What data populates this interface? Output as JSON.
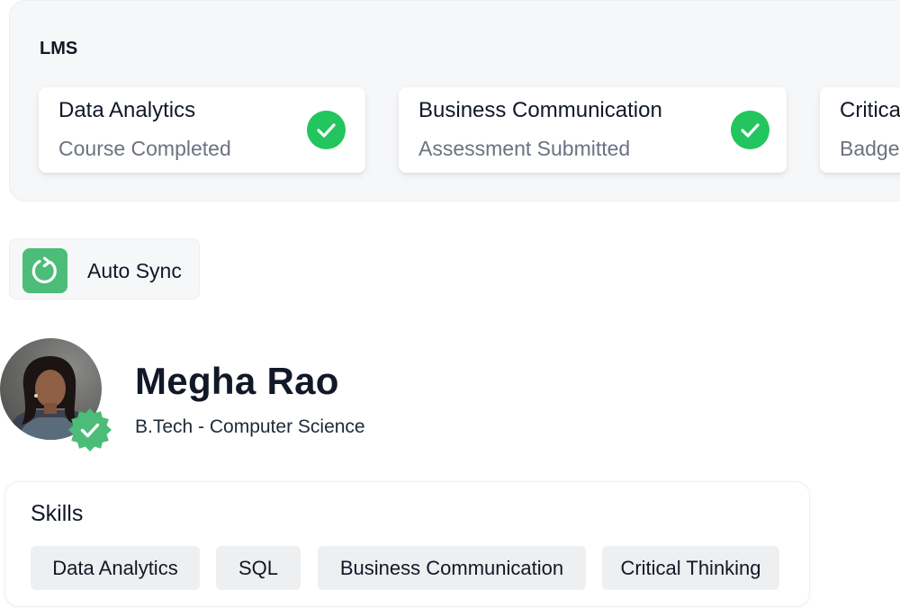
{
  "lms": {
    "title": "LMS",
    "cards": [
      {
        "title": "Data Analytics",
        "status": "Course Completed",
        "icon": "check-circle-icon"
      },
      {
        "title": "Business Communication",
        "status": "Assessment Submitted",
        "icon": "check-circle-icon"
      },
      {
        "title": "Critical Thinking",
        "status": "Badge Earned"
      }
    ]
  },
  "auto_sync": {
    "label": "Auto Sync",
    "icon": "refresh-icon"
  },
  "profile": {
    "name": "Megha Rao",
    "degree": "B.Tech - Computer Science",
    "verified_icon": "verified-badge-icon"
  },
  "skills": {
    "title": "Skills",
    "items": [
      "Data Analytics",
      "SQL",
      "Business Communication",
      "Critical Thinking"
    ]
  },
  "colors": {
    "success_green": "#22c55e",
    "sync_green": "#4bbd78",
    "panel_bg": "#f6f7f8",
    "chip_bg": "#eeeff1",
    "muted_text": "#6b7280"
  }
}
